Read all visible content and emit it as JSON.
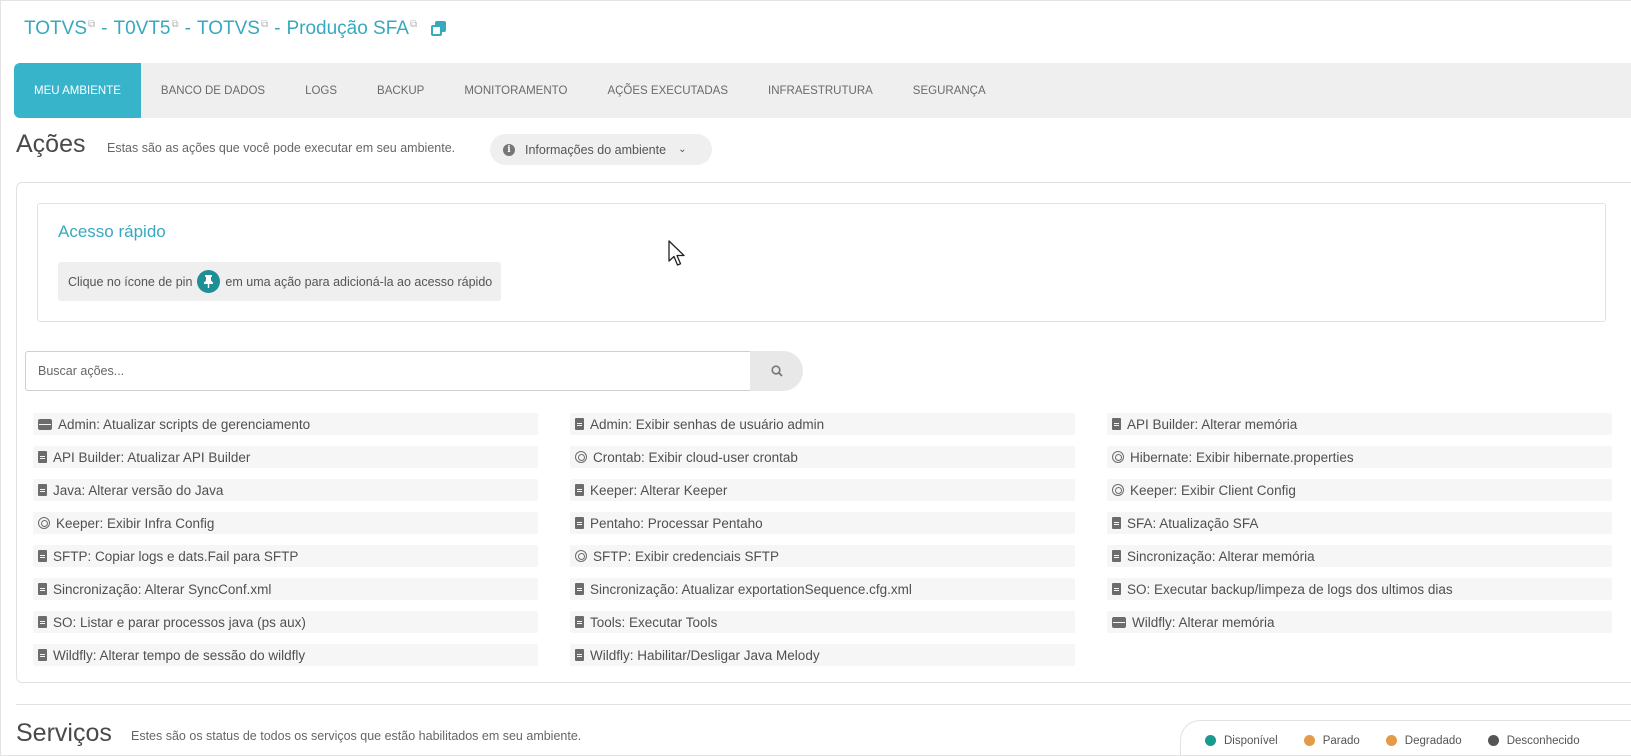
{
  "breadcrumb": {
    "items": [
      "TOTVS",
      "T0VT5",
      "TOTVS",
      "Produção SFA"
    ],
    "separator": "-"
  },
  "tabs": [
    {
      "label": "MEU AMBIENTE",
      "active": true
    },
    {
      "label": "BANCO DE DADOS",
      "active": false
    },
    {
      "label": "LOGS",
      "active": false
    },
    {
      "label": "BACKUP",
      "active": false
    },
    {
      "label": "MONITORAMENTO",
      "active": false
    },
    {
      "label": "AÇÕES EXECUTADAS",
      "active": false
    },
    {
      "label": "INFRAESTRUTURA",
      "active": false
    },
    {
      "label": "SEGURANÇA",
      "active": false
    }
  ],
  "actions_section": {
    "title": "Ações",
    "subtitle": "Estas são as ações que você pode executar em seu ambiente.",
    "env_button_label": "Informações do ambiente"
  },
  "quick_access": {
    "title": "Acesso rápido",
    "hint_before": "Clique no ícone de pin",
    "hint_after": "em uma ação para adicioná-la ao acesso rápido"
  },
  "search": {
    "placeholder": "Buscar ações..."
  },
  "actions": [
    {
      "label": "Admin: Atualizar scripts de gerenciamento",
      "icon": "server-icon"
    },
    {
      "label": "Admin: Exibir senhas de usuário admin",
      "icon": "document-icon"
    },
    {
      "label": "API Builder: Alterar memória",
      "icon": "document-icon"
    },
    {
      "label": "API Builder: Atualizar API Builder",
      "icon": "document-icon"
    },
    {
      "label": "Crontab: Exibir cloud-user crontab",
      "icon": "eye-icon"
    },
    {
      "label": "Hibernate: Exibir hibernate.properties",
      "icon": "eye-icon"
    },
    {
      "label": "Java: Alterar versão do Java",
      "icon": "document-icon"
    },
    {
      "label": "Keeper: Alterar Keeper",
      "icon": "document-icon"
    },
    {
      "label": "Keeper: Exibir Client Config",
      "icon": "eye-icon"
    },
    {
      "label": "Keeper: Exibir Infra Config",
      "icon": "eye-icon"
    },
    {
      "label": "Pentaho: Processar Pentaho",
      "icon": "document-icon"
    },
    {
      "label": "SFA: Atualização SFA",
      "icon": "document-icon"
    },
    {
      "label": "SFTP: Copiar logs e dats.Fail para SFTP",
      "icon": "document-icon"
    },
    {
      "label": "SFTP: Exibir credenciais SFTP",
      "icon": "eye-icon"
    },
    {
      "label": "Sincronização: Alterar memória",
      "icon": "document-icon"
    },
    {
      "label": "Sincronização: Alterar SyncConf.xml",
      "icon": "document-icon"
    },
    {
      "label": "Sincronização: Atualizar exportationSequence.cfg.xml",
      "icon": "document-icon"
    },
    {
      "label": "SO: Executar backup/limpeza de logs dos ultimos dias",
      "icon": "document-icon"
    },
    {
      "label": "SO: Listar e parar processos java (ps aux)",
      "icon": "document-icon"
    },
    {
      "label": "Tools: Executar Tools",
      "icon": "document-icon"
    },
    {
      "label": "Wildfly: Alterar memória",
      "icon": "server-icon"
    },
    {
      "label": "Wildfly: Alterar tempo de sessão do wildfly",
      "icon": "document-icon"
    },
    {
      "label": "Wildfly: Habilitar/Desligar Java Melody",
      "icon": "document-icon"
    }
  ],
  "services_section": {
    "title": "Serviços",
    "subtitle": "Estes são os status de todos os serviços que estão habilitados em seu ambiente."
  },
  "legend": [
    {
      "label": "Disponível",
      "color": "#1a9a8f"
    },
    {
      "label": "Parado",
      "color": "#e39a4a"
    },
    {
      "label": "Degradado",
      "color": "#e39a4a"
    },
    {
      "label": "Desconhecido",
      "color": "#555555"
    }
  ],
  "colors": {
    "accent": "#37b4c9",
    "link": "#37a9bf",
    "pin": "#1f8f96"
  }
}
